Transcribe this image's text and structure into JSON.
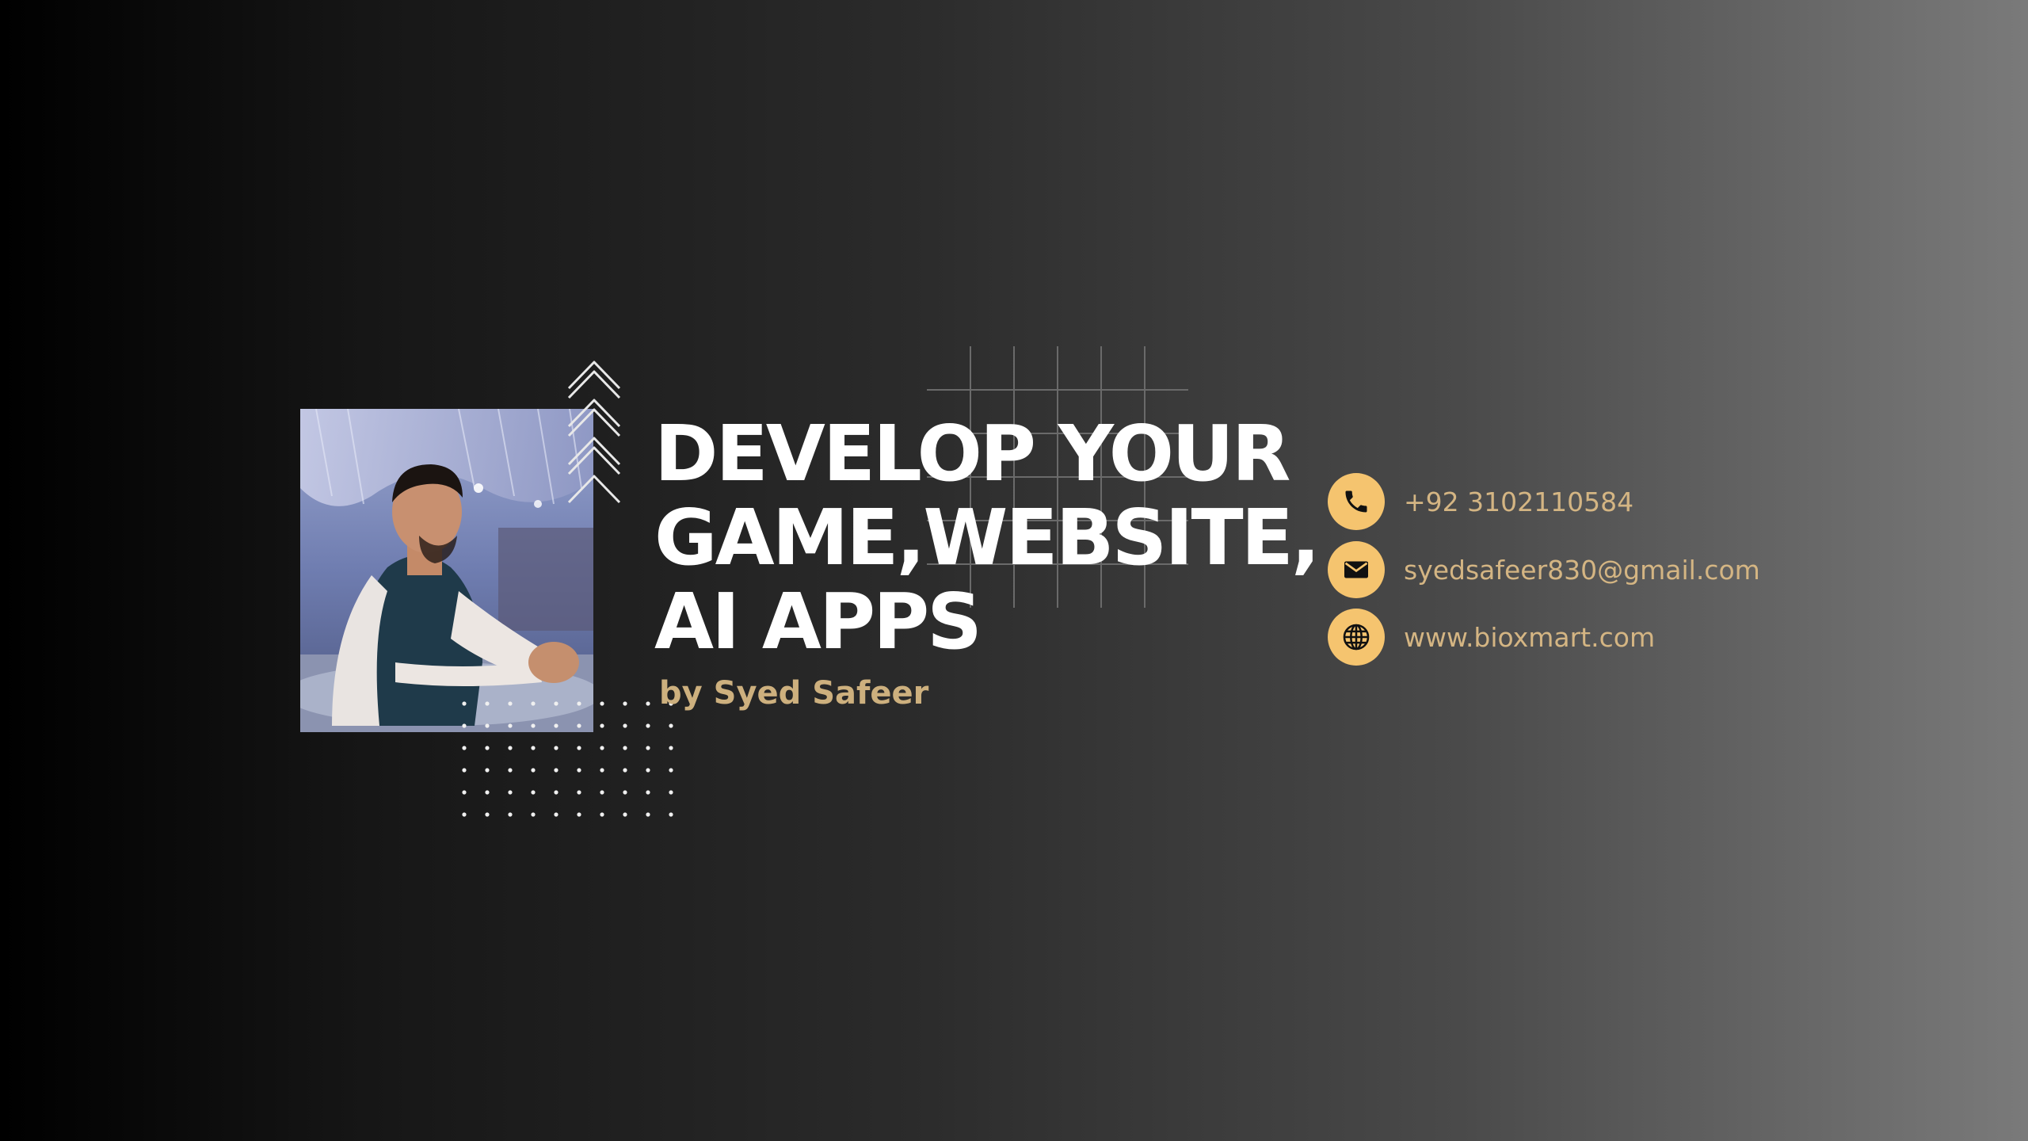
{
  "headline": {
    "line1": "DEVELOP YOUR",
    "line2": "GAME,WEBSITE,",
    "line3": "AI APPS"
  },
  "byline": "by Syed Safeer",
  "contacts": [
    {
      "icon": "phone-icon",
      "text": "+92 3102110584"
    },
    {
      "icon": "mail-icon",
      "text": "syedsafeer830@gmail.com"
    },
    {
      "icon": "globe-icon",
      "text": "www.bioxmart.com"
    }
  ],
  "colors": {
    "accent": "#f5c46f",
    "accent_text": "#d4b583",
    "byline": "#cdb07e",
    "headline": "#ffffff"
  }
}
